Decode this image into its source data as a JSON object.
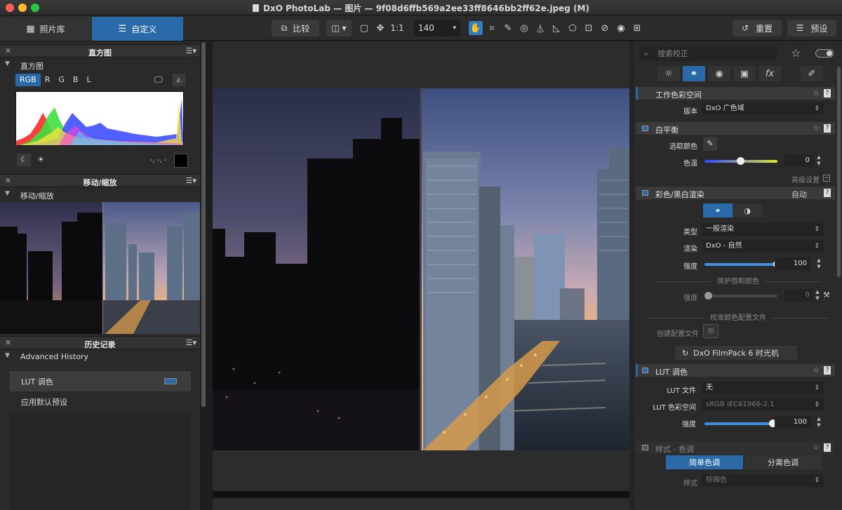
{
  "window": {
    "title": "DxO PhotoLab — 图片 — 9f08d6ffb569a2ee33ff8646bb2ff62e.jpeg (M)"
  },
  "tabs": {
    "library": "照片库",
    "customize": "自定义"
  },
  "toolbar": {
    "compare": "比较",
    "one_to_one": "1:1",
    "zoom": "140",
    "reset": "重置",
    "presets": "预设"
  },
  "left": {
    "histogram": {
      "panel_title": "直方图",
      "sub_title": "直方图",
      "channels": [
        "RGB",
        "R",
        "G",
        "B",
        "L"
      ],
      "readout": "-, -, -"
    },
    "navigator": {
      "panel_title": "移动/缩放",
      "sub_title": "移动/缩放"
    },
    "history": {
      "panel_title": "历史记录",
      "sub_title": "Advanced History",
      "items": [
        "LUT 调色",
        "应用默认预设"
      ]
    }
  },
  "right": {
    "search_placeholder": "搜索校正",
    "working_space": {
      "title": "工作色彩空间",
      "version_label": "版本",
      "version_value": "DxO 广色域"
    },
    "white_balance": {
      "title": "白平衡",
      "pick_label": "选取颜色",
      "temp_label": "色温",
      "temp_value": "0",
      "temp_level": 0.5,
      "advanced": "高级设置"
    },
    "color_render": {
      "title": "彩色/黑白渲染",
      "auto": "自动",
      "type_label": "类型",
      "type_value": "一般渲染",
      "render_label": "渲染",
      "render_value": "DxO - 自然",
      "strength_label": "强度",
      "strength_value": "100",
      "strength_level": 1.0,
      "protect_title": "保护饱和颜色",
      "protect_label": "强度",
      "protect_value": "0",
      "calib_title": "校准颜色配置文件",
      "create_profile": "创建配置文件",
      "filmpack_button": "DxO FilmPack 6 时光机"
    },
    "lut": {
      "title": "LUT 调色",
      "file_label": "LUT 文件",
      "file_value": "无",
      "space_label": "LUT 色彩空间",
      "space_value": "sRGB IEC61966-2.1",
      "strength_label": "强度",
      "strength_value": "100",
      "strength_level": 1.0
    },
    "style_toning": {
      "title": "样式 - 色调",
      "tab_simple": "简单色调",
      "tab_split": "分离色调",
      "style_label": "样式",
      "style_value": "棕褐色"
    }
  }
}
